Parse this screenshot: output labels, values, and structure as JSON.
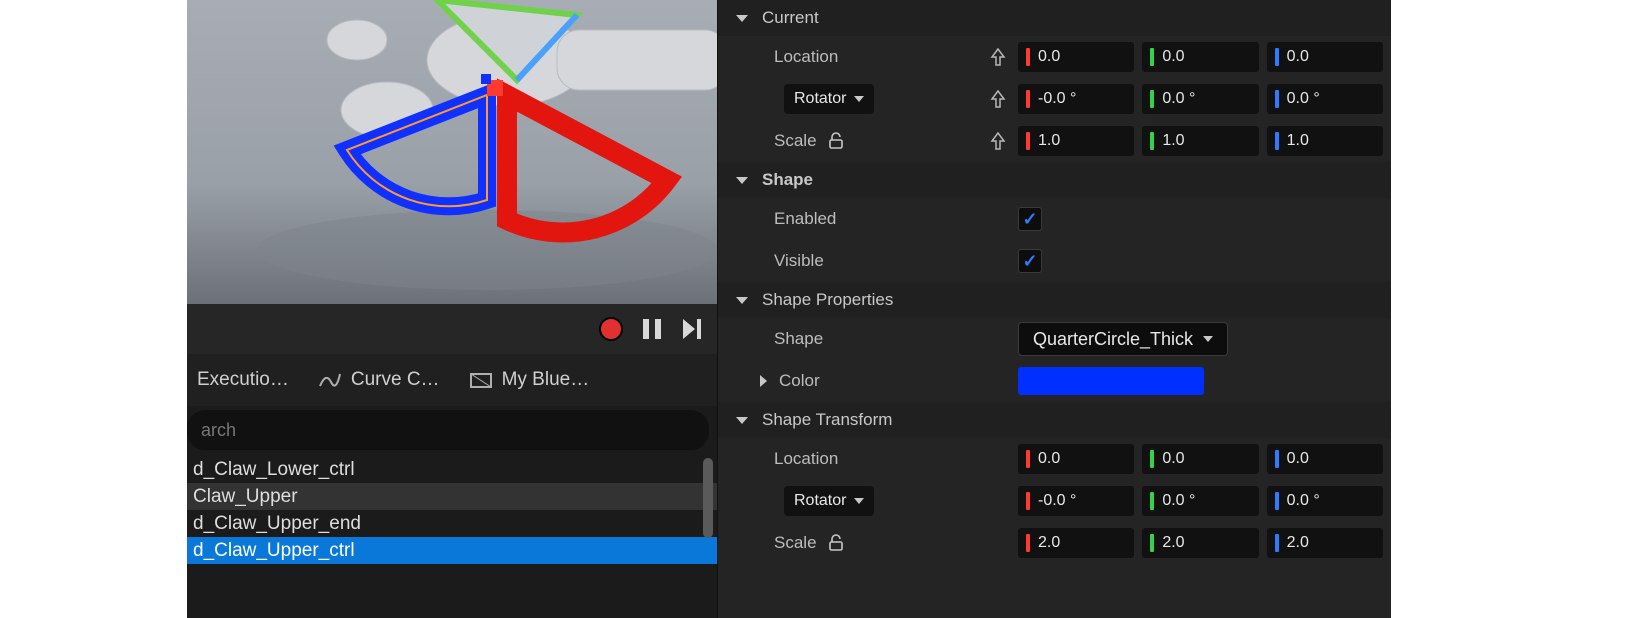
{
  "playbar": {
    "recording": true
  },
  "tabs": [
    {
      "label": "Executio…"
    },
    {
      "label": "Curve C…"
    },
    {
      "label": "My Blue…"
    }
  ],
  "search": {
    "placeholder": "arch"
  },
  "outliner": {
    "items": [
      {
        "label": "d_Claw_Lower_ctrl",
        "state": "normal"
      },
      {
        "label": "Claw_Upper",
        "state": "alt"
      },
      {
        "label": "d_Claw_Upper_end",
        "state": "normal"
      },
      {
        "label": "d_Claw_Upper_ctrl",
        "state": "selected"
      },
      {
        "label": "",
        "state": "normal"
      }
    ]
  },
  "sections": {
    "current": {
      "title": "Current",
      "location_label": "Location",
      "rotator_label": "Rotator",
      "scale_label": "Scale",
      "loc": {
        "x": "0.0",
        "y": "0.0",
        "z": "0.0"
      },
      "rot": {
        "x": "-0.0 °",
        "y": "0.0 °",
        "z": "0.0 °"
      },
      "scale": {
        "x": "1.0",
        "y": "1.0",
        "z": "1.0"
      }
    },
    "shape": {
      "title": "Shape",
      "enabled_label": "Enabled",
      "visible_label": "Visible",
      "enabled": true,
      "visible": true
    },
    "shape_props": {
      "title": "Shape Properties",
      "shape_label": "Shape",
      "shape_value": "QuarterCircle_Thick",
      "color_label": "Color",
      "color_value": "#0030ff"
    },
    "shape_xf": {
      "title": "Shape Transform",
      "location_label": "Location",
      "rotator_label": "Rotator",
      "scale_label": "Scale",
      "loc": {
        "x": "0.0",
        "y": "0.0",
        "z": "0.0"
      },
      "rot": {
        "x": "-0.0 °",
        "y": "0.0 °",
        "z": "0.0 °"
      },
      "scale": {
        "x": "2.0",
        "y": "2.0",
        "z": "2.0"
      }
    }
  }
}
